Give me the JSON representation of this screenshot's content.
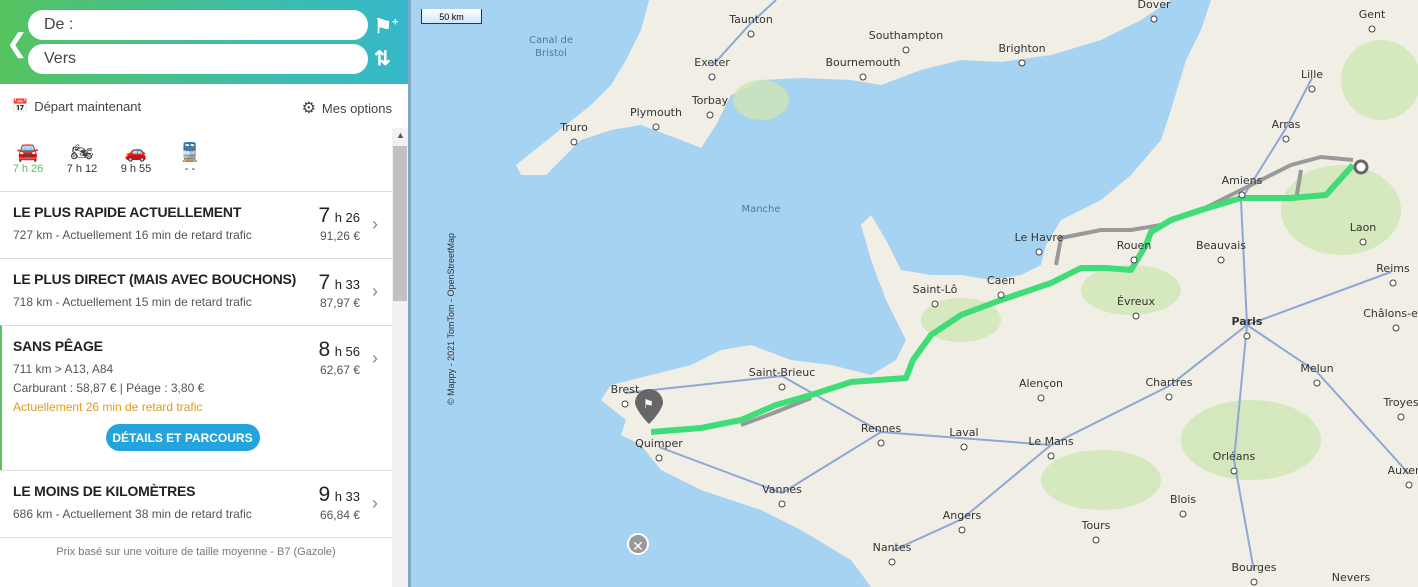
{
  "search": {
    "from_label": "De :",
    "to_label": "Vers"
  },
  "toolbar": {
    "departure": "Départ maintenant",
    "options": "Mes options"
  },
  "modes": [
    {
      "icon": "car-icon",
      "time": "7 h 26",
      "active": true
    },
    {
      "icon": "motorbike-icon",
      "time": "7 h 12"
    },
    {
      "icon": "car-alt-icon",
      "time": "9 h 55"
    },
    {
      "icon": "train-icon",
      "time": "- -"
    }
  ],
  "routes": [
    {
      "title": "LE PLUS RAPIDE ACTUELLEMENT",
      "summary": "727 km - Actuellement 16 min de retard trafic",
      "hours": "7",
      "minutes": "h 26",
      "price": "91,26 €"
    },
    {
      "title": "LE PLUS DIRECT (MAIS AVEC BOUCHONS)",
      "summary": "718 km - Actuellement 15 min de retard trafic",
      "hours": "7",
      "minutes": "h 33",
      "price": "87,97 €"
    },
    {
      "title": "SANS PÊAGE",
      "summary": "711 km   >   A13, A84",
      "costs": "Carburant : 58,87 € | Péage : 3,80 €",
      "warning": "Actuellement 26 min de retard trafic",
      "button": "DÉTAILS ET PARCOURS",
      "hours": "8",
      "minutes": "h 56",
      "price": "62,67 €"
    },
    {
      "title": "LE MOINS DE KILOMÈTRES",
      "summary": "686 km - Actuellement 38 min de retard trafic",
      "hours": "9",
      "minutes": "h 33",
      "price": "66,84 €"
    }
  ],
  "footer": "Prix basé sur une voiture de taille moyenne - B7 (Gazole)",
  "map": {
    "scale": "50 km",
    "attribution": "© Mappy - 2021 TomTom - OpenStreetMap",
    "seas": [
      "Canal de",
      "Bristol",
      "Manche"
    ],
    "cities": [
      "Taunton",
      "Southampton",
      "Brighton",
      "Dover",
      "Gent",
      "Exeter",
      "Bournemouth",
      "Lille",
      "Torbay",
      "Plymouth",
      "Truro",
      "Arras",
      "Amiens",
      "Le Havre",
      "Rouen",
      "Beauvais",
      "Laon",
      "Reims",
      "Caen",
      "Saint-Lô",
      "Évreux",
      "Paris",
      "Châlons-en-",
      "Brest",
      "Saint-Brieuc",
      "Alençon",
      "Chartres",
      "Melun",
      "Troyes",
      "Quimper",
      "Rennes",
      "Laval",
      "Le Mans",
      "Orléans",
      "Auxerre",
      "Vannes",
      "Blois",
      "Angers",
      "Tours",
      "Nantes",
      "Bourges",
      "Nevers"
    ],
    "colors": {
      "route": "#3fdc78",
      "alt_route": "#999999",
      "sea": "#a6d3f2",
      "land": "#f1eee6"
    }
  }
}
